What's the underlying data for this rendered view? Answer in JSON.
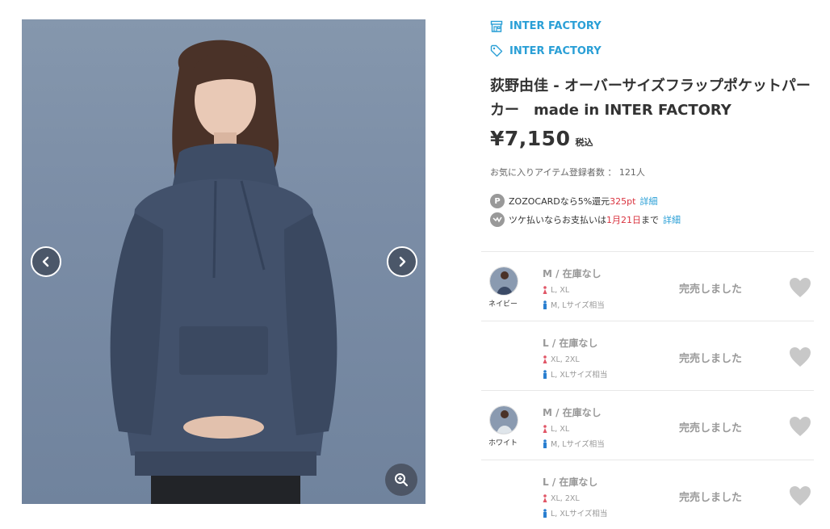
{
  "gallery": {
    "prev_icon": "chevron-left-icon",
    "next_icon": "chevron-right-icon",
    "zoom_icon": "zoom-in-icon"
  },
  "shop": {
    "name": "INTER FACTORY",
    "icon": "shop-icon"
  },
  "brand": {
    "name": "INTER FACTORY",
    "icon": "tag-icon"
  },
  "product": {
    "title": "荻野由佳 - オーバーサイズフラップポケットパーカー　made in INTER FACTORY",
    "price": "¥7,150",
    "tax_label": "税込",
    "favorite_count": "お気に入りアイテム登録者数 ： 121人"
  },
  "promos": {
    "zozocard": {
      "icon": "P",
      "text_before": "ZOZOCARDなら5%還元",
      "points": "325pt",
      "link": "詳細"
    },
    "tsuke": {
      "text_before": "ツケ払いならお支払いは",
      "date": "1月21日",
      "text_after": "まで",
      "link": "詳細"
    }
  },
  "skus": [
    {
      "color": "ネイビー",
      "swatch": "#3b4a66",
      "size": "M / 在庫なし",
      "female_fit": "L, XL",
      "male_fit": "M, Lサイズ相当",
      "status": "完売しました"
    },
    {
      "color": "",
      "swatch": "",
      "size": "L / 在庫なし",
      "female_fit": "XL, 2XL",
      "male_fit": "L, XLサイズ相当",
      "status": "完売しました"
    },
    {
      "color": "ホワイト",
      "swatch": "#dfe5ea",
      "size": "M / 在庫なし",
      "female_fit": "L, XL",
      "male_fit": "M, Lサイズ相当",
      "status": "完売しました"
    },
    {
      "color": "",
      "swatch": "",
      "size": "L / 在庫なし",
      "female_fit": "XL, 2XL",
      "male_fit": "L, XLサイズ相当",
      "status": "完売しました"
    }
  ],
  "colors": {
    "link": "#2a9fd6",
    "accent_red": "#d9333f",
    "muted": "#999999",
    "female_icon": "#e05566",
    "male_icon": "#2a7fd0"
  }
}
